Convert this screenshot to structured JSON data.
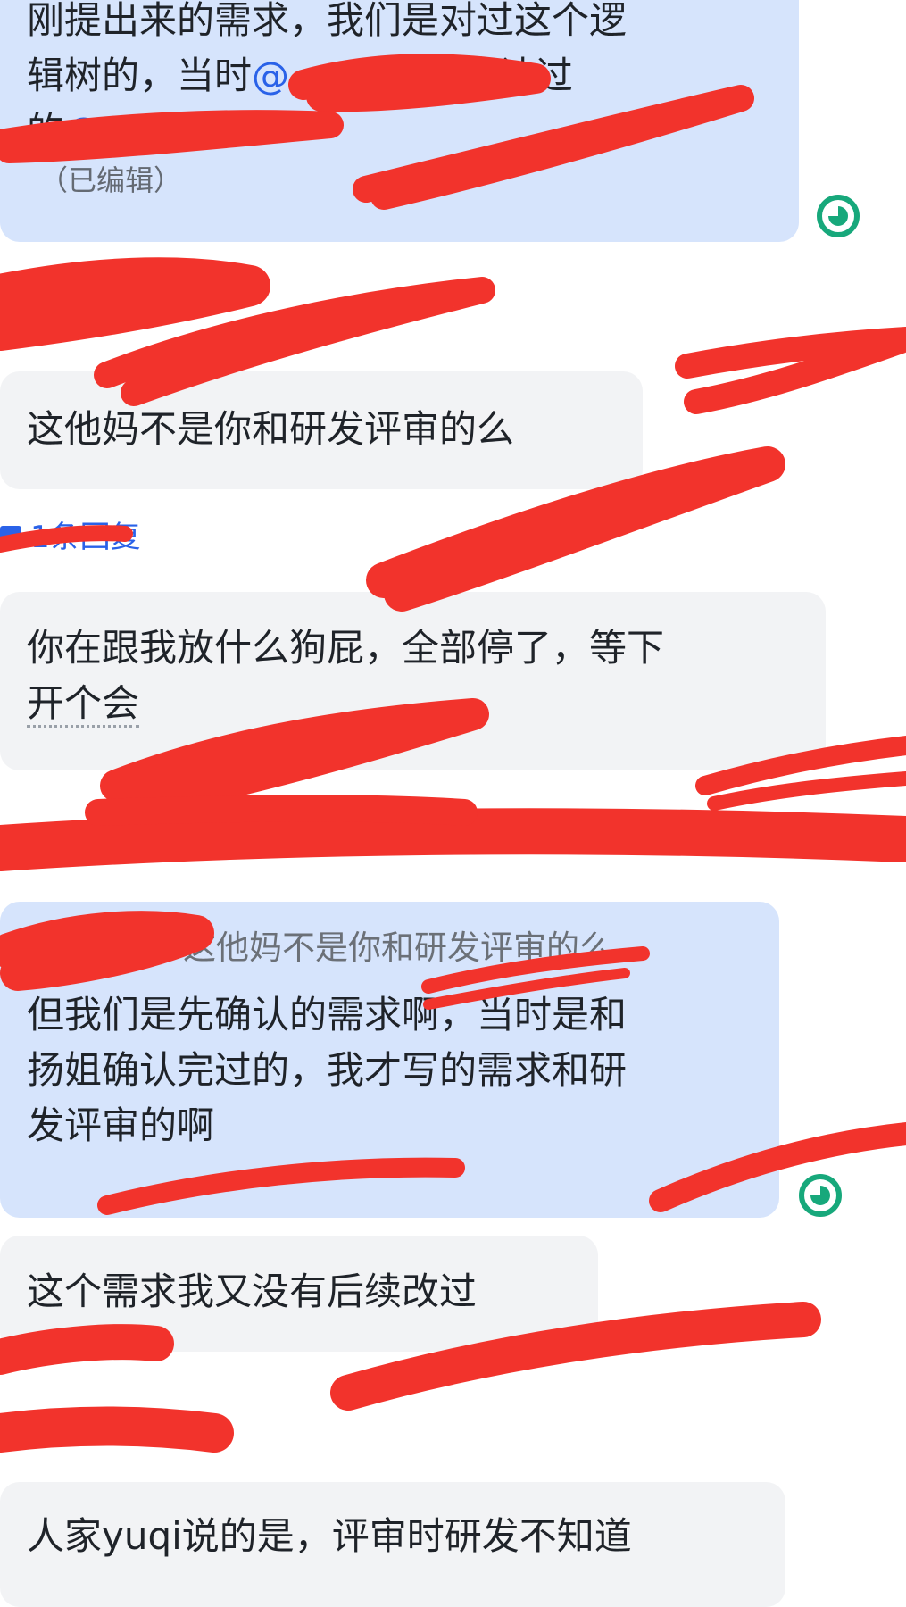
{
  "messages": {
    "m1": {
      "line1": "刚提出来的需求，我们是对过这个逻",
      "line2_a": "辑树的，当时",
      "line2_b": "是确认过",
      "line3": "的",
      "edited": "（已编辑）"
    },
    "m2": {
      "text": "这他妈不是你和研发评审的么"
    },
    "reply": {
      "label": "1条回复"
    },
    "m3": {
      "line1": "你在跟我放什么狗屁，全部停了，等下",
      "line2": "开个会"
    },
    "m4": {
      "quote": "这他妈不是你和研发评审的么",
      "line1": "但我们是先确认的需求啊，当时是和",
      "line2": "扬姐确认完过的，我才写的需求和研",
      "line3": "发评审的啊"
    },
    "m5": {
      "text": "这个需求我又没有后续改过"
    },
    "m6": {
      "text": "人家yuqi说的是，评审时研发不知道"
    }
  },
  "icons": {
    "read_receipt": "read-receipt-icon",
    "reply_thread": "thread-reply-icon"
  },
  "colors": {
    "my_bubble": "#d6e4fc",
    "their_bubble": "#f2f3f5",
    "mention": "#2a62e8",
    "read_receipt": "#17a87b",
    "redaction": "#f2332c"
  }
}
